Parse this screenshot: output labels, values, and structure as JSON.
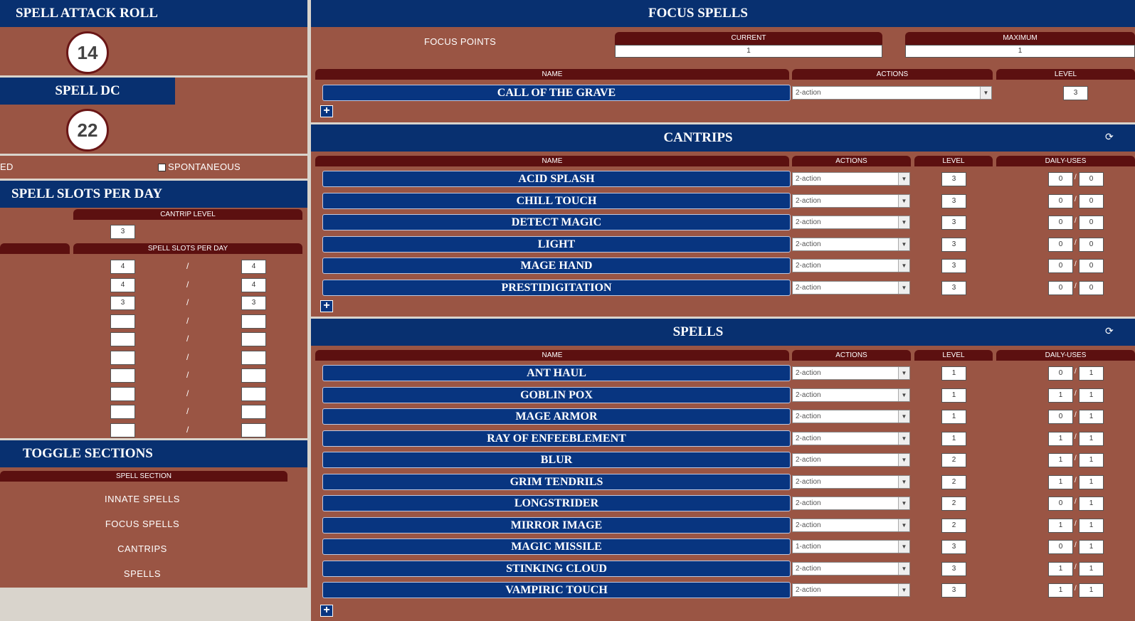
{
  "left": {
    "spell_attack": {
      "title": "SPELL ATTACK ROLL",
      "value": "14"
    },
    "spell_dc": {
      "title": "SPELL DC",
      "value": "22"
    },
    "prepared_label": "ED",
    "spontaneous_label": "SPONTANEOUS",
    "slots": {
      "title": "SPELL SLOTS PER DAY",
      "cantrip_level_header": "CANTRIP LEVEL",
      "cantrip_level_value": "3",
      "per_day_header": "SPELL SLOTS PER DAY",
      "rows": [
        {
          "current": "4",
          "max": "4"
        },
        {
          "current": "4",
          "max": "4"
        },
        {
          "current": "3",
          "max": "3"
        },
        {
          "current": "",
          "max": ""
        },
        {
          "current": "",
          "max": ""
        },
        {
          "current": "",
          "max": ""
        },
        {
          "current": "",
          "max": ""
        },
        {
          "current": "",
          "max": ""
        },
        {
          "current": "",
          "max": ""
        },
        {
          "current": "",
          "max": ""
        }
      ],
      "slash": "/"
    },
    "toggle": {
      "title": "TOGGLE SECTIONS",
      "header": "SPELL SECTION",
      "items": [
        "INNATE SPELLS",
        "FOCUS SPELLS",
        "CANTRIPS",
        "SPELLS"
      ]
    }
  },
  "focus": {
    "title": "FOCUS SPELLS",
    "points_label": "FOCUS POINTS",
    "current_label": "CURRENT",
    "current_value": "1",
    "maximum_label": "MAXIMUM",
    "maximum_value": "1",
    "col_name": "NAME",
    "col_actions": "ACTIONS",
    "col_level": "LEVEL",
    "spells": [
      {
        "name": "CALL OF THE GRAVE",
        "action": "2-action",
        "level": "3"
      }
    ]
  },
  "cantrips": {
    "title": "CANTRIPS",
    "col_name": "NAME",
    "col_actions": "ACTIONS",
    "col_level": "LEVEL",
    "col_uses": "DAILY-USES",
    "spells": [
      {
        "name": "ACID SPLASH",
        "action": "2-action",
        "level": "3",
        "used": "0",
        "max": "0"
      },
      {
        "name": "CHILL TOUCH",
        "action": "2-action",
        "level": "3",
        "used": "0",
        "max": "0"
      },
      {
        "name": "DETECT MAGIC",
        "action": "2-action",
        "level": "3",
        "used": "0",
        "max": "0"
      },
      {
        "name": "LIGHT",
        "action": "2-action",
        "level": "3",
        "used": "0",
        "max": "0"
      },
      {
        "name": "MAGE HAND",
        "action": "2-action",
        "level": "3",
        "used": "0",
        "max": "0"
      },
      {
        "name": "PRESTIDIGITATION",
        "action": "2-action",
        "level": "3",
        "used": "0",
        "max": "0"
      }
    ]
  },
  "spells": {
    "title": "SPELLS",
    "col_name": "NAME",
    "col_actions": "ACTIONS",
    "col_level": "LEVEL",
    "col_uses": "DAILY-USES",
    "spells": [
      {
        "name": "ANT HAUL",
        "action": "2-action",
        "level": "1",
        "used": "0",
        "max": "1"
      },
      {
        "name": "GOBLIN POX",
        "action": "2-action",
        "level": "1",
        "used": "1",
        "max": "1"
      },
      {
        "name": "MAGE ARMOR",
        "action": "2-action",
        "level": "1",
        "used": "0",
        "max": "1"
      },
      {
        "name": "RAY OF ENFEEBLEMENT",
        "action": "2-action",
        "level": "1",
        "used": "1",
        "max": "1"
      },
      {
        "name": "BLUR",
        "action": "2-action",
        "level": "2",
        "used": "1",
        "max": "1"
      },
      {
        "name": "GRIM TENDRILS",
        "action": "2-action",
        "level": "2",
        "used": "1",
        "max": "1"
      },
      {
        "name": "LONGSTRIDER",
        "action": "2-action",
        "level": "2",
        "used": "0",
        "max": "1"
      },
      {
        "name": "MIRROR IMAGE",
        "action": "2-action",
        "level": "2",
        "used": "1",
        "max": "1"
      },
      {
        "name": "MAGIC MISSILE",
        "action": "1-action",
        "level": "3",
        "used": "0",
        "max": "1"
      },
      {
        "name": "STINKING CLOUD",
        "action": "2-action",
        "level": "3",
        "used": "1",
        "max": "1"
      },
      {
        "name": "VAMPIRIC TOUCH",
        "action": "2-action",
        "level": "3",
        "used": "1",
        "max": "1"
      }
    ]
  },
  "icons": {
    "plus": "+",
    "refresh": "⟳",
    "dropdown": "▼"
  }
}
